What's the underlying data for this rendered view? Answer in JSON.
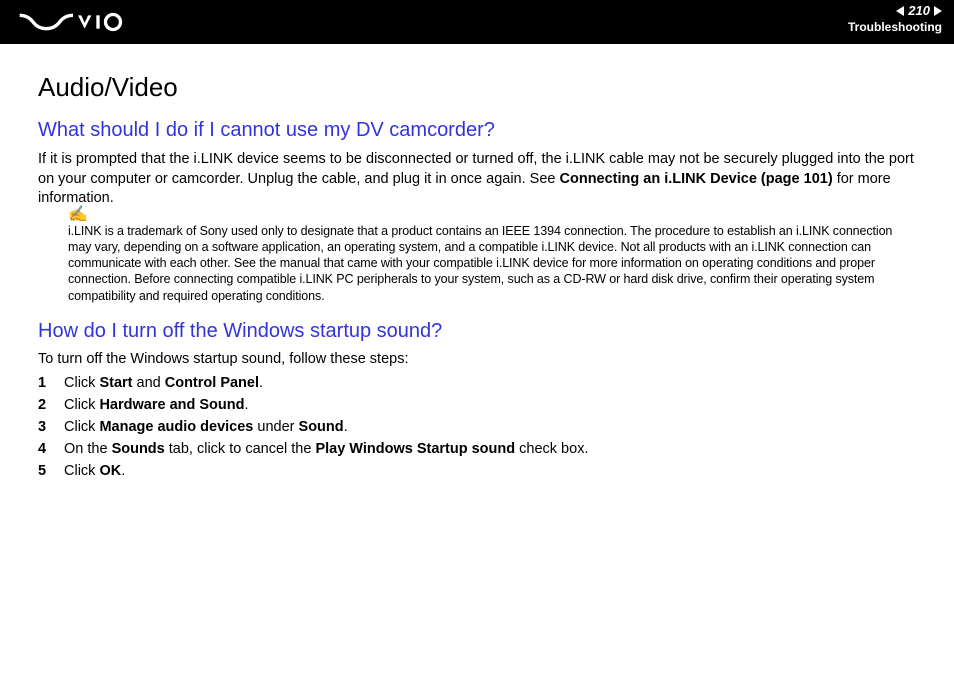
{
  "header": {
    "page_number": "210",
    "section": "Troubleshooting"
  },
  "content": {
    "h1": "Audio/Video",
    "q1": {
      "heading": "What should I do if I cannot use my DV camcorder?",
      "p_pre": "If it is prompted that the i.LINK device seems to be disconnected or turned off, the i.LINK cable may not be securely plugged into the port on your computer or camcorder. Unplug the cable, and plug it in once again. See ",
      "p_bold": "Connecting an i.LINK Device (page 101)",
      "p_post": " for more information.",
      "note": "i.LINK is a trademark of Sony used only to designate that a product contains an IEEE 1394 connection. The procedure to establish an i.LINK connection may vary, depending on a software application, an operating system, and a compatible i.LINK device. Not all products with an i.LINK connection can communicate with each other. See the manual that came with your compatible i.LINK device for more information on operating conditions and proper connection. Before connecting compatible i.LINK PC peripherals to your system, such as a CD-RW or hard disk drive, confirm their operating system compatibility and required operating conditions."
    },
    "q2": {
      "heading": "How do I turn off the Windows startup sound?",
      "intro": "To turn off the Windows startup sound, follow these steps:",
      "steps": {
        "s1a": "Click ",
        "s1b": "Start",
        "s1c": " and ",
        "s1d": "Control Panel",
        "s1e": ".",
        "s2a": "Click ",
        "s2b": "Hardware and Sound",
        "s2c": ".",
        "s3a": "Click ",
        "s3b": "Manage audio devices",
        "s3c": " under ",
        "s3d": "Sound",
        "s3e": ".",
        "s4a": "On the ",
        "s4b": "Sounds",
        "s4c": " tab, click to cancel the ",
        "s4d": "Play Windows Startup sound",
        "s4e": " check box.",
        "s5a": "Click ",
        "s5b": "OK",
        "s5c": "."
      }
    }
  }
}
